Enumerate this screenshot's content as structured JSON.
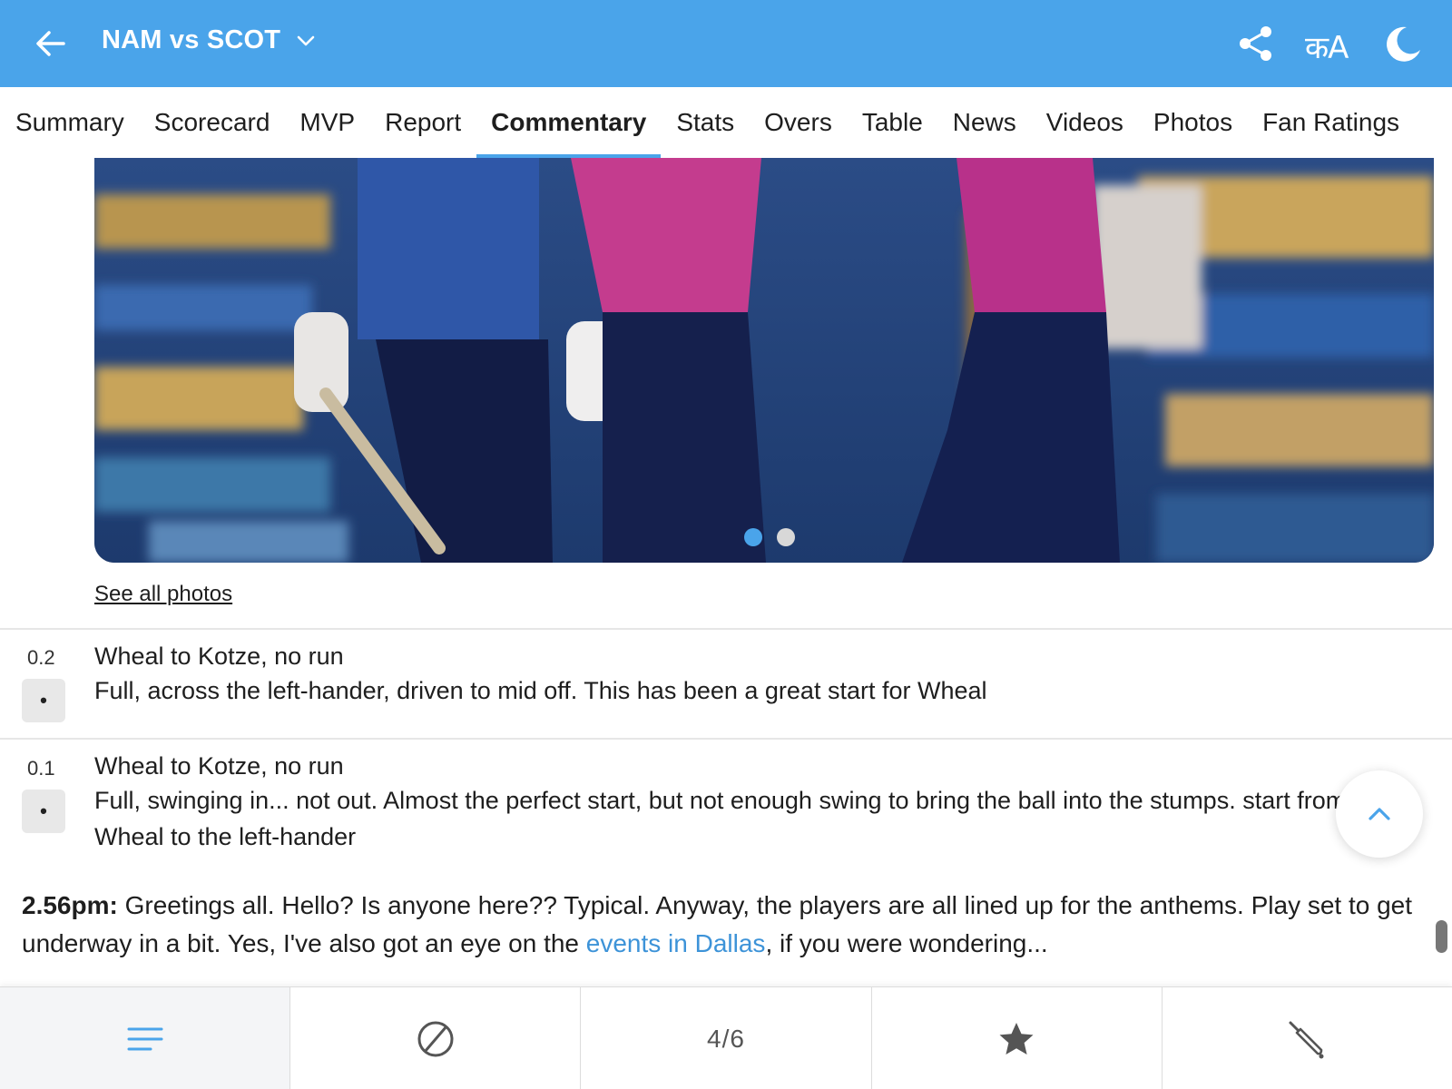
{
  "header": {
    "title": "NAM vs SCOT",
    "lang_toggle": "कA",
    "colors": {
      "bar": "#4aa4ea",
      "text": "#ffffff"
    },
    "icons": [
      "back-arrow-icon",
      "chevron-down-icon",
      "share-icon",
      "language-icon",
      "moon-icon"
    ]
  },
  "tabs": [
    {
      "label": "Summary"
    },
    {
      "label": "Scorecard"
    },
    {
      "label": "MVP"
    },
    {
      "label": "Report"
    },
    {
      "label": "Commentary",
      "active": true
    },
    {
      "label": "Stats"
    },
    {
      "label": "Overs"
    },
    {
      "label": "Table"
    },
    {
      "label": "News"
    },
    {
      "label": "Videos"
    },
    {
      "label": "Photos"
    },
    {
      "label": "Fan Ratings"
    }
  ],
  "gallery": {
    "see_all": "See all photos",
    "current_slide": 1,
    "total_slides": 2
  },
  "commentary": [
    {
      "over": "0.2",
      "result": "•",
      "title": "Wheal to Kotze, no run",
      "text": "Full, across the left-hander, driven to mid off. This has been a great start for Wheal"
    },
    {
      "over": "0.1",
      "result": "•",
      "title": "Wheal to Kotze, no run",
      "text": "Full, swinging in... not out. Almost the perfect start, but not enough swing to bring the ball into the stumps. start from Wheal to the left-hander"
    }
  ],
  "note": {
    "time": "2.56pm:",
    "text_before": " Greetings all. Hello? Is anyone here?? Typical. Anyway, the players are all lined up for the anthems. Play set to get underway in a bit. Yes, I've also got an eye on the ",
    "link": "events in Dallas",
    "text_after": ", if you were wondering..."
  },
  "bottom_nav": {
    "items": [
      {
        "icon": "commentary-lines-icon",
        "active": true
      },
      {
        "icon": "cricket-ball-icon"
      },
      {
        "label": "4/6"
      },
      {
        "icon": "star-icon"
      },
      {
        "icon": "cricket-bat-icon"
      }
    ]
  }
}
